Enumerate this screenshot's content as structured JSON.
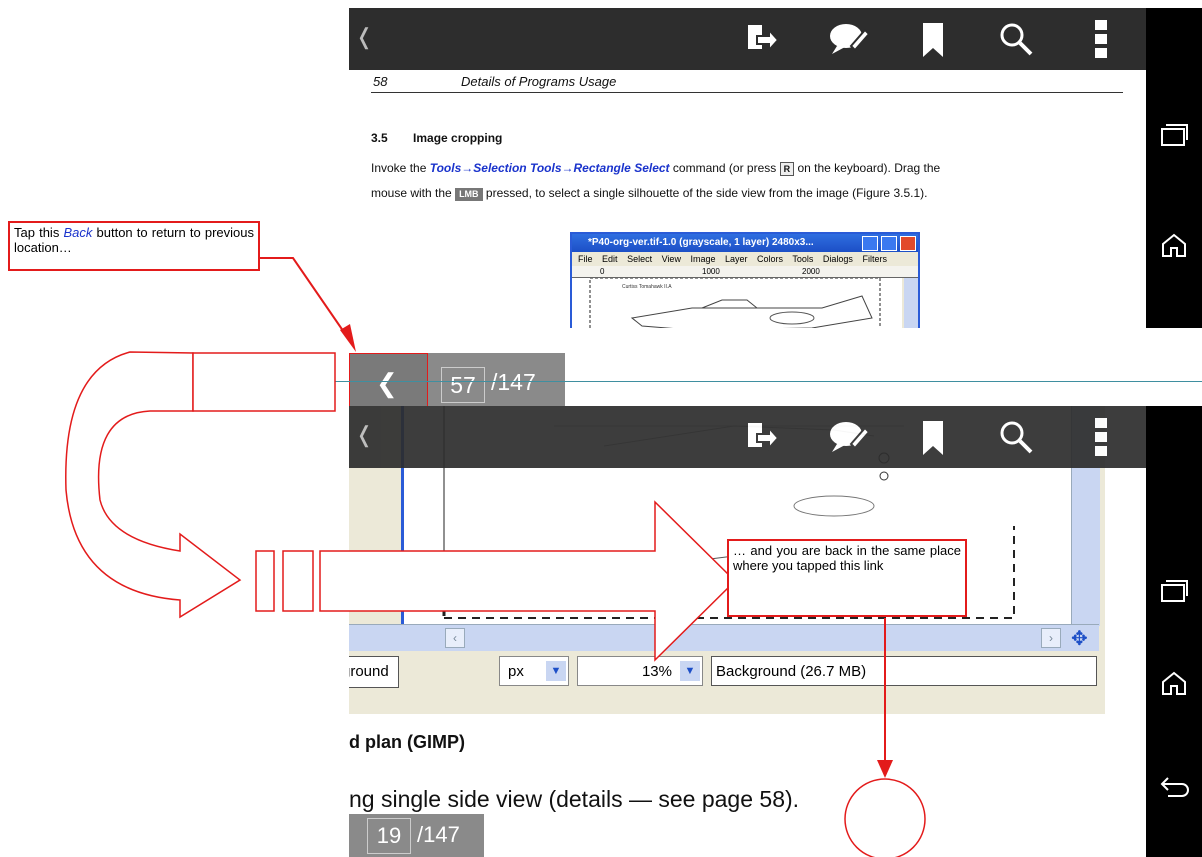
{
  "top": {
    "toolbar": {
      "back_glyph": "❬",
      "icons": [
        "export-icon",
        "annotate-icon",
        "bookmark-icon",
        "search-icon",
        "overflow-menu-icon"
      ]
    },
    "page": {
      "running_header_number": "58",
      "running_header_title": "Details of Programs Usage",
      "section_number": "3.5",
      "section_title": "Image cropping",
      "para_invoke": "Invoke the",
      "para_command": "Tools→Selection Tools→Rectangle Select",
      "para_rest1": "command (or press",
      "key_r": "R",
      "para_rest2": "on the keyboard). Drag the",
      "para_line2a": "mouse with the",
      "key_lmb": "LMB",
      "para_line2b": "pressed,  to select a single silhouette of the side view from the image (Figure 3.5.1).",
      "gimp_window": {
        "title": "*P40-org-ver.tif-1.0 (grayscale, 1 layer) 2480x3...",
        "menu": [
          "File",
          "Edit",
          "Select",
          "View",
          "Image",
          "Layer",
          "Colors",
          "Tools",
          "Dialogs",
          "Filters"
        ],
        "ruler_marks": [
          "0",
          "1000",
          "2000"
        ]
      }
    },
    "pager": {
      "back_glyph": "❮",
      "current": "57",
      "total": "/147"
    }
  },
  "bottom": {
    "toolbar": {
      "back_glyph": "❬"
    },
    "page": {
      "unit": "px",
      "zoom": "13%",
      "layer_info": "Background (26.7 MB)",
      "left_field": "ground",
      "heading": "d plan (GIMP)",
      "body_text": "ng single side view (details — see page",
      "link_number": "58",
      "link_trailing": ")."
    },
    "pager": {
      "current": "19",
      "total": "/147"
    }
  },
  "callouts": {
    "back_tip_a": "Tap this",
    "back_tip_back": "Back",
    "back_tip_b": "button to return to previous location…",
    "return_tip": "… and you are back in the same place where you tapped this link"
  },
  "colors": {
    "annotation_red": "#e31b1b",
    "toolbar_bg": "#2d2d2d",
    "link_blue": "#1a33cc",
    "divider": "#3f8fa0"
  }
}
